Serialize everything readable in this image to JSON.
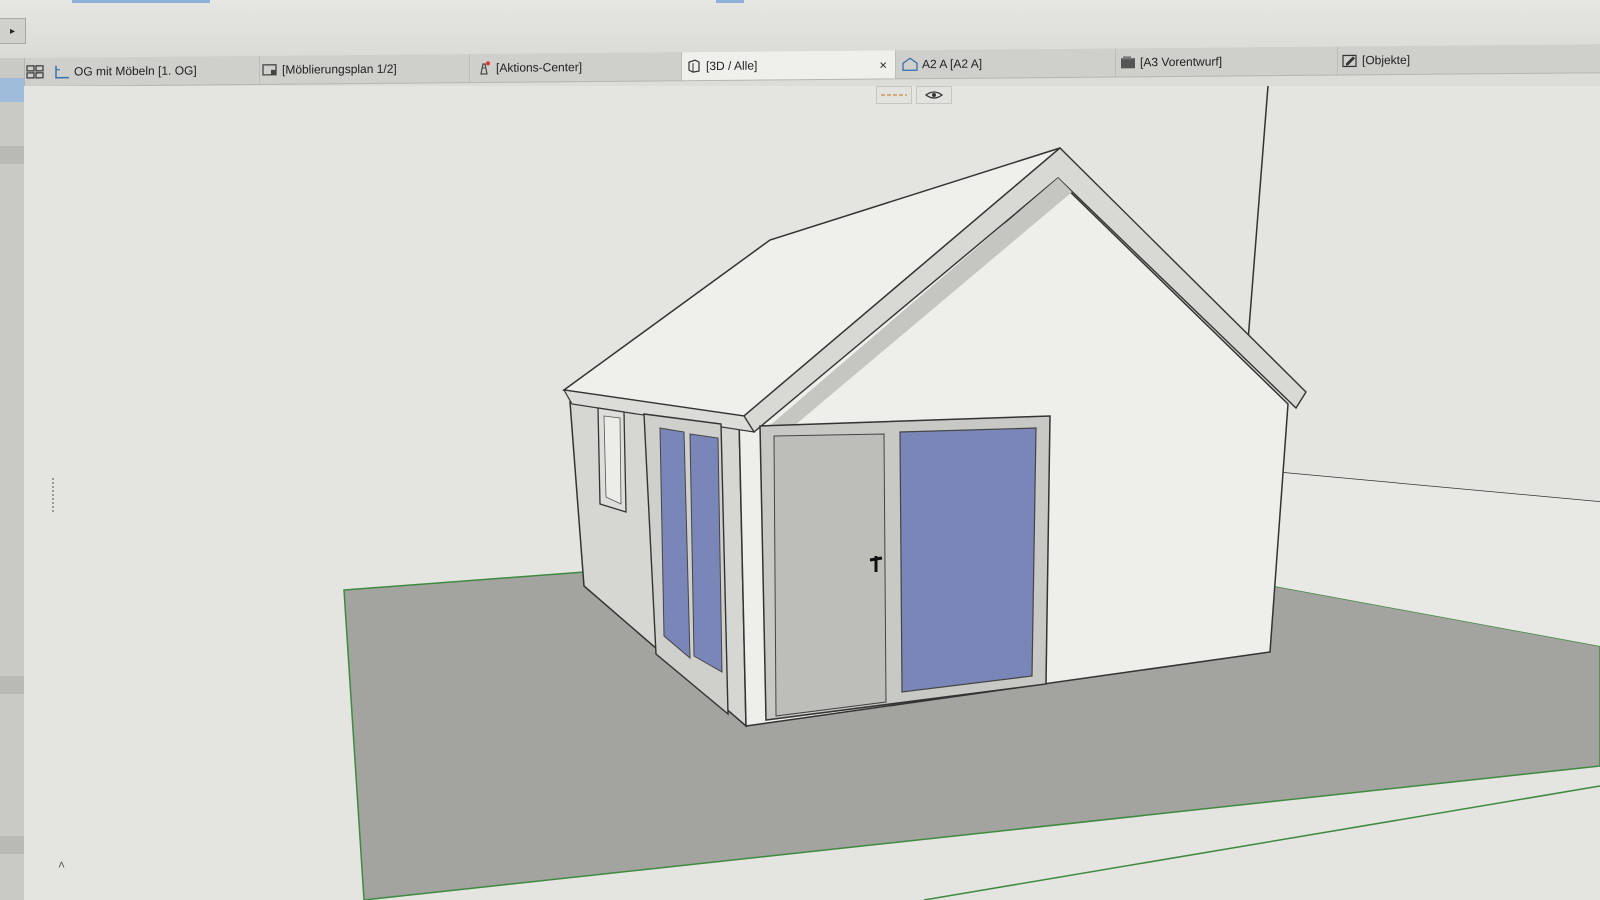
{
  "tabs": [
    {
      "label": "OG mit Möbeln [1. OG]",
      "icon": "floor-plan-icon",
      "active": false
    },
    {
      "label": "[Möblierungsplan 1/2]",
      "icon": "layout-icon",
      "active": false
    },
    {
      "label": "[Aktions-Center]",
      "icon": "action-center-icon",
      "active": false
    },
    {
      "label": "[3D / Alle]",
      "icon": "3d-view-icon",
      "active": true,
      "close_symbol": "×"
    },
    {
      "label": "A2 A [A2 A]",
      "icon": "section-icon",
      "active": false
    },
    {
      "label": "[A3 Vorentwurf]",
      "icon": "sheet-icon",
      "active": false
    },
    {
      "label": "[Objekte]",
      "icon": "edit-objects-icon",
      "active": false
    }
  ],
  "tab_bar": {
    "grid_icon": "grid-icon"
  },
  "view_tools": [
    {
      "icon": "dashed-line-icon"
    },
    {
      "icon": "eye-icon"
    }
  ],
  "toolbar": {
    "play_icon": "play-icon",
    "play_symbol": "▸"
  },
  "status": {
    "scroll_up_symbol": "˄"
  },
  "colors": {
    "accent_blue": "#8fb0d8",
    "glass": "#7a86b8",
    "wall": "#eeeeeb",
    "ground": "#a3a3a0",
    "ground_edge": "#3f8a3f"
  }
}
